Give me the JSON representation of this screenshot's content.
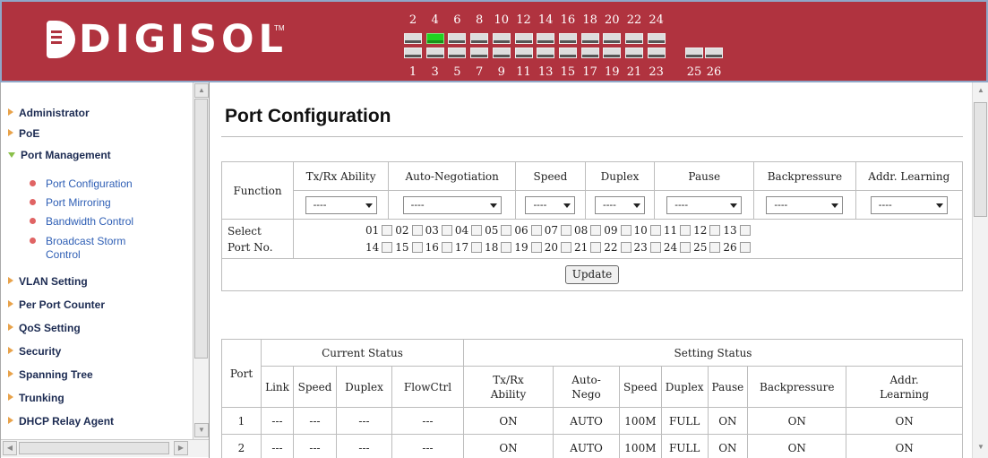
{
  "brand": {
    "name": "DIGISOL",
    "tm": "TM"
  },
  "ports": {
    "top": [
      "2",
      "4",
      "6",
      "8",
      "10",
      "12",
      "14",
      "16",
      "18",
      "20",
      "22",
      "24"
    ],
    "bottom": [
      "1",
      "3",
      "5",
      "7",
      "9",
      "11",
      "13",
      "15",
      "17",
      "19",
      "21",
      "23"
    ],
    "extra": [
      "25",
      "26"
    ],
    "active": "4"
  },
  "menu": {
    "administrator": "Administrator",
    "poe": "PoE",
    "port_management": "Port Management",
    "port_configuration": "Port Configuration",
    "port_mirroring": "Port Mirroring",
    "bandwidth_control": "Bandwidth Control",
    "broadcast_storm_control": "Broadcast Storm Control",
    "vlan_setting": "VLAN Setting",
    "per_port_counter": "Per Port Counter",
    "qos_setting": "QoS Setting",
    "security": "Security",
    "spanning_tree": "Spanning Tree",
    "trunking": "Trunking",
    "dhcp_relay_agent": "DHCP Relay Agent"
  },
  "page": {
    "title": "Port Configuration"
  },
  "config": {
    "function_label": "Function",
    "headers": {
      "txrx": "Tx/Rx Ability",
      "autoneg": "Auto-Negotiation",
      "speed": "Speed",
      "duplex": "Duplex",
      "pause": "Pause",
      "backpressure": "Backpressure",
      "addr": "Addr. Learning"
    },
    "selects": {
      "txrx": "----",
      "autoneg": "----",
      "speed": "----",
      "duplex": "----",
      "pause": "----",
      "backpressure": "----",
      "addr": "----"
    },
    "select_port_label_1": "Select",
    "select_port_label_2": "Port No.",
    "port_row1": [
      "01",
      "02",
      "03",
      "04",
      "05",
      "06",
      "07",
      "08",
      "09",
      "10",
      "11",
      "12",
      "13"
    ],
    "port_row2": [
      "14",
      "15",
      "16",
      "17",
      "18",
      "19",
      "20",
      "21",
      "22",
      "23",
      "24",
      "25",
      "26"
    ],
    "update_label": "Update"
  },
  "status": {
    "port_label": "Port",
    "current_label": "Current Status",
    "setting_label": "Setting Status",
    "current_cols": [
      "Link",
      "Speed",
      "Duplex",
      "FlowCtrl"
    ],
    "setting_cols": {
      "txrx_1": "Tx/Rx",
      "txrx_2": "Ability",
      "auto_1": "Auto-",
      "auto_2": "Nego",
      "speed": "Speed",
      "duplex": "Duplex",
      "pause": "Pause",
      "backpressure": "Backpressure",
      "addr_1": "Addr.",
      "addr_2": "Learning"
    },
    "rows": [
      {
        "port": "1",
        "link": "---",
        "speed": "---",
        "duplex": "---",
        "flowctrl": "---",
        "txrx": "ON",
        "auto": "AUTO",
        "sspeed": "100M",
        "sduplex": "FULL",
        "pause": "ON",
        "backpressure": "ON",
        "addr": "ON"
      },
      {
        "port": "2",
        "link": "---",
        "speed": "---",
        "duplex": "---",
        "flowctrl": "---",
        "txrx": "ON",
        "auto": "AUTO",
        "sspeed": "100M",
        "sduplex": "FULL",
        "pause": "ON",
        "backpressure": "ON",
        "addr": "ON"
      }
    ]
  }
}
